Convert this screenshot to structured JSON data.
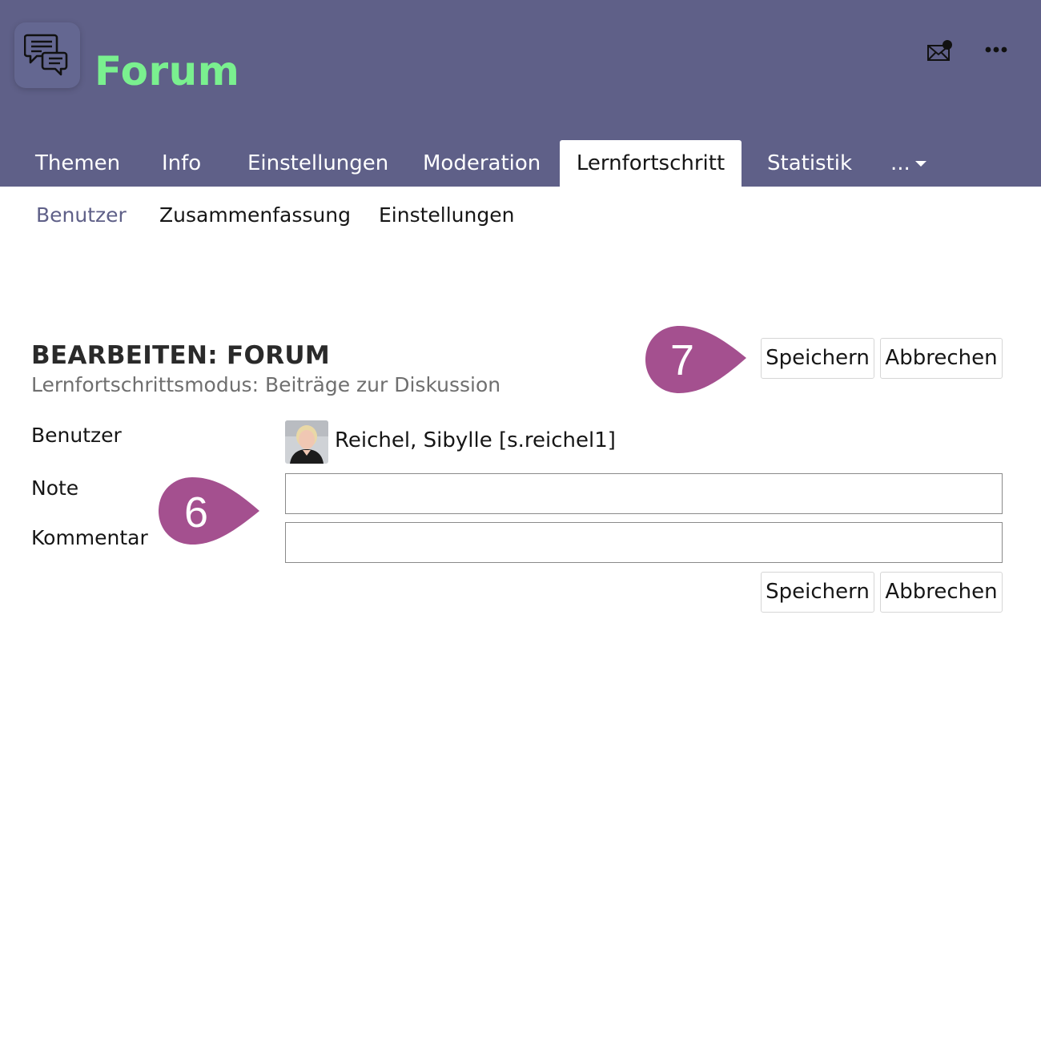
{
  "header": {
    "title": "Forum",
    "app_icon": "forum-chat-bubbles-icon",
    "actions": [
      {
        "icon": "mail-notification-icon",
        "has_notification": true
      },
      {
        "icon": "more-horizontal-icon"
      }
    ],
    "background_color": "#5f6088",
    "title_color": "#7af08f"
  },
  "tabs": [
    {
      "label": "Themen"
    },
    {
      "label": "Info"
    },
    {
      "label": "Einstellungen"
    },
    {
      "label": "Moderation"
    },
    {
      "label": "Lernfortschritt",
      "active": true
    },
    {
      "label": "Statistik"
    },
    {
      "label": "..."
    }
  ],
  "subtabs": [
    {
      "label": "Benutzer",
      "active": true
    },
    {
      "label": "Zusammenfassung"
    },
    {
      "label": "Einstellungen"
    }
  ],
  "form": {
    "title": "BEARBEITEN: FORUM",
    "subtitle": "Lernfortschrittsmodus: Beiträge zur Diskussion",
    "save_label": "Speichern",
    "cancel_label": "Abbrechen",
    "fields": {
      "user_label": "Benutzer",
      "user_value": "Reichel, Sibylle [s.reichel1]",
      "note_label": "Note",
      "note_value": "",
      "comment_label": "Kommentar",
      "comment_value": ""
    }
  },
  "markers": [
    {
      "number": "6"
    },
    {
      "number": "7"
    }
  ],
  "marker_color": "#a4508f"
}
